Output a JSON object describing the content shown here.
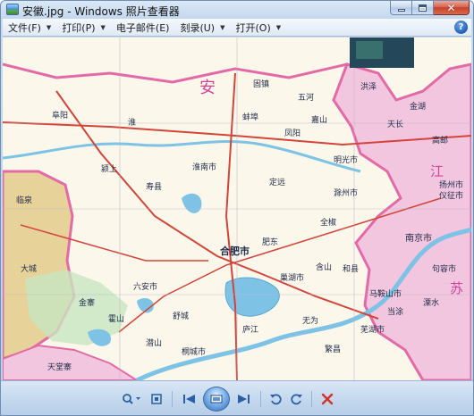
{
  "window": {
    "title": "安徽.jpg - Windows 照片查看器"
  },
  "menubar": {
    "items": [
      {
        "label": "文件(F)"
      },
      {
        "label": "打印(P)"
      },
      {
        "label": "电子邮件(E)"
      },
      {
        "label": "刻录(U)"
      },
      {
        "label": "打开(O)"
      }
    ],
    "help_label": "?"
  },
  "map": {
    "places": {
      "dacheng": "大城",
      "fuyang": "阜阳",
      "huainan": "淮南市",
      "huai_district": "淮",
      "bengbu": "蚌埠",
      "fengyang": "凤阳",
      "chuzhou": "滁州市",
      "an_big": "安",
      "lu_an": "六安市",
      "hefei": "合肥市",
      "chaohu": "巢湖市",
      "nanjing": "南京市",
      "jiang_big": "江",
      "su_big": "苏",
      "maanshan": "马鞍山市",
      "wuhu": "芜湖市",
      "tongcheng": "桐城市",
      "huoshan": "霍山",
      "tiantangzhai": "天堂寨",
      "yizheng": "仪征市",
      "yangzhou": "扬州市",
      "tianchang": "天长",
      "gaoyou": "高邮",
      "jinhu": "金湖",
      "jurong": "句容市",
      "lishui": "溧水",
      "dangtu": "当涂",
      "shouxian": "寿县",
      "feidong": "肥东",
      "lujiang": "庐江",
      "shucheng": "舒城",
      "hanshan": "含山",
      "hexian": "和县",
      "quanjiao": "全椒",
      "dingyuan": "定远",
      "mingguang": "明光市",
      "linquan": "临泉",
      "wuhe": "五河",
      "jiashan": "嘉山",
      "hongze": "洪泽",
      "qianshan": "潜山",
      "wuwei": "无为",
      "fanchang": "繁昌",
      "jinzhai": "金寨",
      "yingshang": "颍上",
      "guzhen": "固镇"
    }
  },
  "toolbar": {
    "zoom": "zoom",
    "fit": "fit",
    "prev": "prev",
    "slideshow": "slideshow",
    "next": "next",
    "rotate_ccw": "rotate-left",
    "rotate_cw": "rotate-right",
    "delete": "delete"
  },
  "colors": {
    "province_jiangsu": "#f1c6de",
    "province_henan": "#e7d39a",
    "province_main": "#fbf7ea",
    "water": "#7ec3e6",
    "border_pink": "#e36aa7",
    "road_red": "#d2453b",
    "delete_red": "#d3312a",
    "toolbar_blue": "#2a5fa6"
  }
}
